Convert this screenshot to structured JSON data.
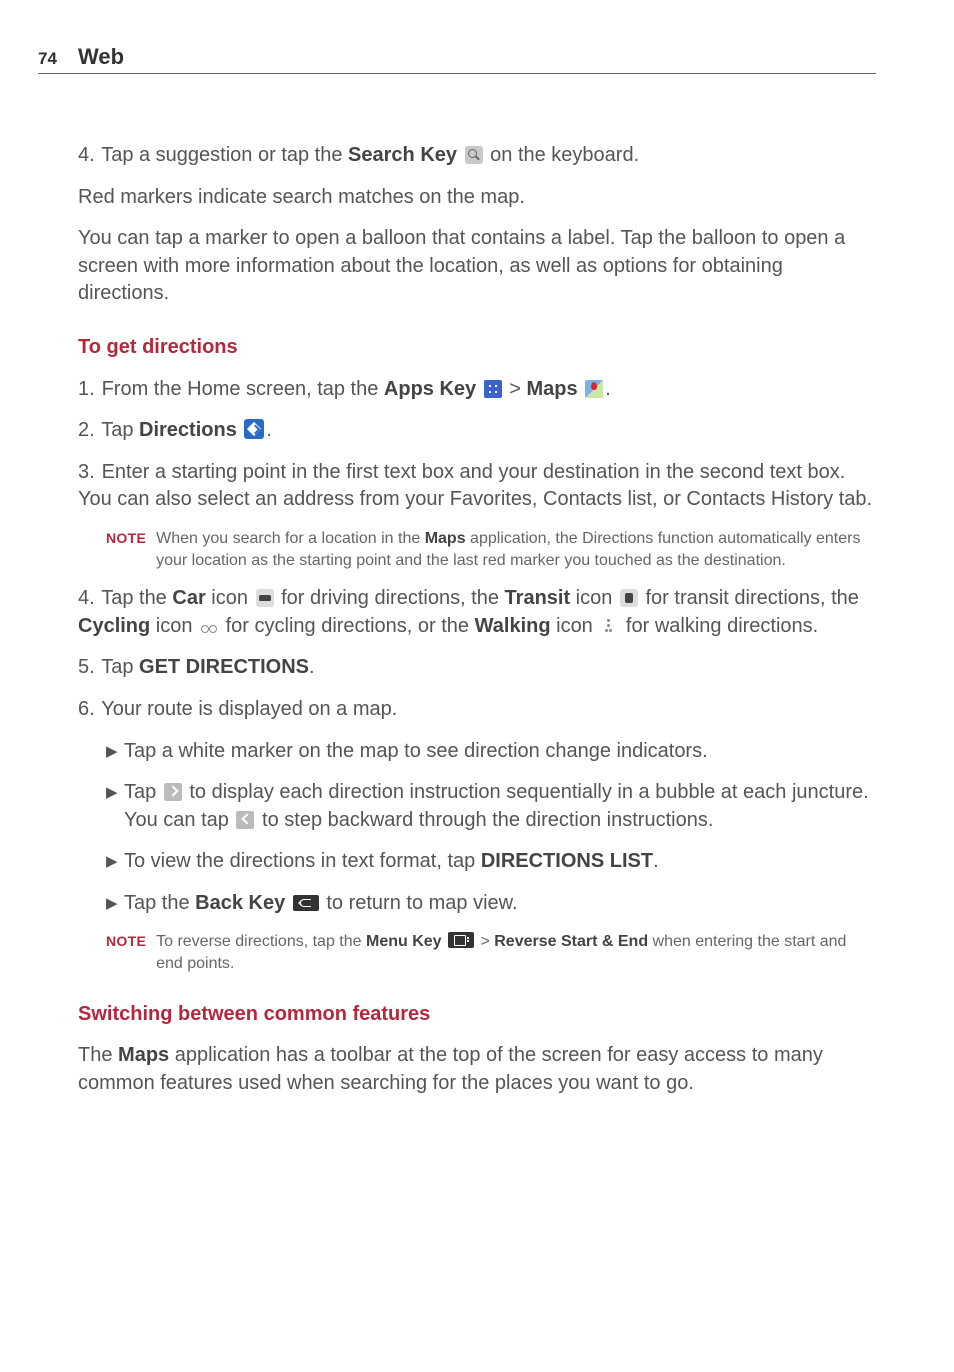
{
  "header": {
    "page_number": "74",
    "section": "Web"
  },
  "p4": {
    "num": "4.",
    "t1": "Tap a suggestion or tap the ",
    "bold1": "Search Key",
    "t2": " on the keyboard.",
    "red_markers": "Red markers indicate search matches on the map.",
    "balloon": "You can tap a marker to open a balloon that contains a label. Tap the balloon to open a screen with more information about the location, as well as options for obtaining directions."
  },
  "h_directions": "To get directions",
  "d1": {
    "num": "1.",
    "t1": "From the Home screen, tap the ",
    "b1": "Apps Key",
    "gt": " > ",
    "b2": "Maps",
    "end": "."
  },
  "d2": {
    "num": "2.",
    "t1": "Tap ",
    "b1": "Directions",
    "end": "."
  },
  "d3": {
    "num": "3.",
    "t": "Enter a starting point in the first text box and your destination in the second text box. You can also select an address from your Favorites, Contacts list, or Contacts History tab."
  },
  "note1": {
    "label": "NOTE",
    "t1": "When you search for a location in the ",
    "b1": "Maps",
    "t2": " application, the Directions function automatically enters your location as the starting point and the last red marker you touched as the destination."
  },
  "d4": {
    "num": "4.",
    "t1": "Tap the ",
    "b1": "Car",
    "t2": " icon ",
    "t3": " for driving directions, the ",
    "b2": "Transit",
    "t4": " icon ",
    "t5": " for transit directions, the ",
    "b3": "Cycling",
    "t6": " icon ",
    "t7": " for cycling directions, or the ",
    "b4": "Walking",
    "t8": " icon ",
    "t9": " for walking directions."
  },
  "d5": {
    "num": "5.",
    "t1": "Tap ",
    "b1": "GET DIRECTIONS",
    "end": "."
  },
  "d6": {
    "num": "6.",
    "t": "Your route is displayed on a map."
  },
  "b": {
    "b1": "Tap a white marker on the map to see direction change indicators.",
    "b2a": "Tap ",
    "b2b": " to display each direction instruction sequentially in a bubble at each juncture. You can tap ",
    "b2c": " to step backward through the direction instructions.",
    "b3a": "To view the directions in text format, tap ",
    "b3b": "DIRECTIONS LIST",
    "b3c": ".",
    "b4a": "Tap the ",
    "b4b": "Back Key",
    "b4c": " to return to map view."
  },
  "note2": {
    "label": "NOTE",
    "t1": "To reverse directions, tap the ",
    "b1": "Menu Key",
    "gt": " > ",
    "b2": "Reverse Start & End",
    "t2": " when entering the start and end points."
  },
  "h_switch": "Switching between common features",
  "switch_p": {
    "t1": "The ",
    "b1": "Maps",
    "t2": " application has a toolbar at the top of the screen for easy access to many common features used when searching for the places you want to go."
  }
}
